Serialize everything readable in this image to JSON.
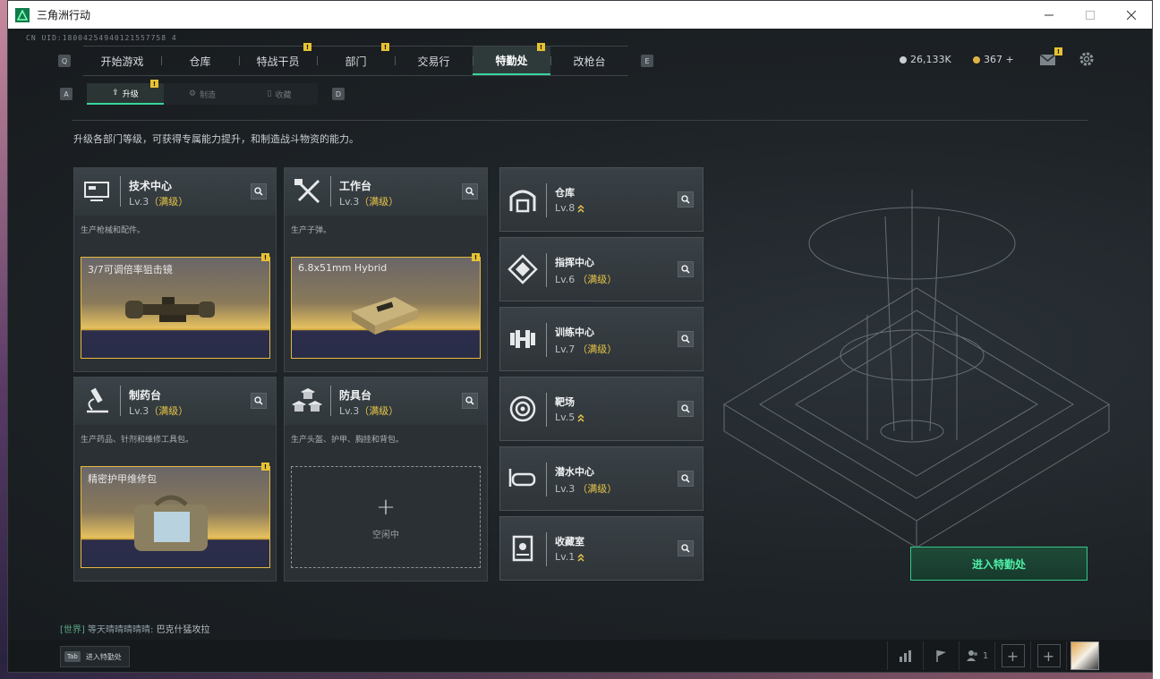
{
  "window": {
    "title": "三角洲行动"
  },
  "uid": "CN UID:18004254940121557758 4",
  "nav": {
    "left_key": "Q",
    "right_key": "E",
    "tabs": [
      {
        "label": "开始游戏",
        "badge": ""
      },
      {
        "label": "仓库",
        "badge": ""
      },
      {
        "label": "特战干员",
        "badge": "!"
      },
      {
        "label": "部门",
        "badge": "!"
      },
      {
        "label": "交易行",
        "badge": ""
      },
      {
        "label": "特勤处",
        "badge": "!"
      },
      {
        "label": "改枪台",
        "badge": ""
      }
    ],
    "active_index": 5
  },
  "currency": {
    "silver": "26,133K",
    "gold": "367 +",
    "mail_badge": "!"
  },
  "subnav": {
    "left_key": "A",
    "right_key": "D",
    "tabs": [
      {
        "label": "升级",
        "badge": "!"
      },
      {
        "label": "制造",
        "badge": ""
      },
      {
        "label": "收藏",
        "badge": ""
      }
    ]
  },
  "description": "升级各部门等级，可获得专属能力提升，和制造战斗物资的能力。",
  "facilities": [
    {
      "name": "技术中心",
      "level": "Lv.3",
      "max": "（满级）",
      "desc": "生产枪械和配件。",
      "product": {
        "name": "3/7可调倍率狙击镜",
        "badge": "!"
      }
    },
    {
      "name": "工作台",
      "level": "Lv.3",
      "max": "（满级）",
      "desc": "生产子弹。",
      "product": {
        "name": "6.8x51mm Hybrid",
        "badge": "!"
      }
    },
    {
      "name": "制药台",
      "level": "Lv.3",
      "max": "（满级）",
      "desc": "生产药品、针剂和维修工具包。",
      "product": {
        "name": "精密护甲维修包",
        "badge": "!"
      }
    },
    {
      "name": "防具台",
      "level": "Lv.3",
      "max": "（满级）",
      "desc": "生产头盔、护甲、胸挂和背包。",
      "idle": "空闲中"
    }
  ],
  "small_facilities": [
    {
      "name": "仓库",
      "level": "Lv.8",
      "max": "",
      "upgradable": true
    },
    {
      "name": "指挥中心",
      "level": "Lv.6",
      "max": "（满级）",
      "upgradable": false
    },
    {
      "name": "训练中心",
      "level": "Lv.7",
      "max": "（满级）",
      "upgradable": false
    },
    {
      "name": "靶场",
      "level": "Lv.5",
      "max": "",
      "upgradable": true
    },
    {
      "name": "潜水中心",
      "level": "Lv.3",
      "max": "（满级）",
      "upgradable": false
    },
    {
      "name": "收藏室",
      "level": "Lv.1",
      "max": "",
      "upgradable": true
    }
  ],
  "enter_button": "进入特勤处",
  "chat": {
    "channel": "[世界]",
    "sender": "等天晴晴晴晴晴:",
    "message": "巴克什猛攻拉"
  },
  "bottom": {
    "tab_key": "Tab",
    "tab_label": "进入特勤处",
    "squad_count": "1"
  },
  "colors": {
    "accent": "#38d59a",
    "gold": "#e8c547",
    "badge": "#e7c232"
  }
}
